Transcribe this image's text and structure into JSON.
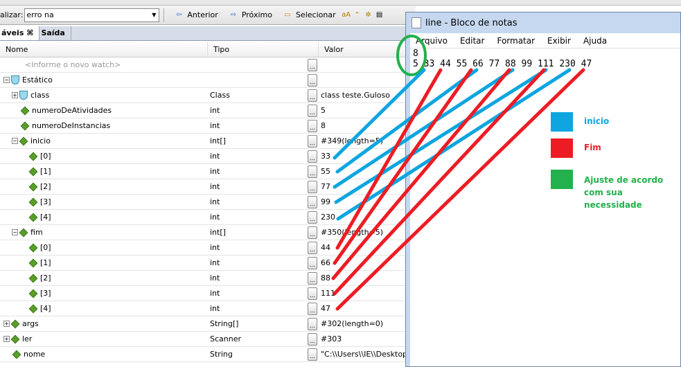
{
  "toolbar": {
    "find_label": "alizar:",
    "find_value": "erro na",
    "prev": "Anterior",
    "next": "Próximo",
    "select": "Selecionar"
  },
  "tabs": [
    {
      "label": "áveis"
    },
    {
      "label": "Saída"
    }
  ],
  "columns": [
    "Nome",
    "Tipo",
    "Valor"
  ],
  "rows": [
    {
      "name": "<Informe o novo watch>",
      "type": "",
      "value": ""
    },
    {
      "name": "Estático",
      "type": "",
      "value": ""
    },
    {
      "name": "class",
      "type": "Class",
      "value": "class teste.Guloso"
    },
    {
      "name": "numeroDeAtividades",
      "type": "int",
      "value": "5"
    },
    {
      "name": "numeroDeInstancias",
      "type": "int",
      "value": "8"
    },
    {
      "name": "inicio",
      "type": "int[]",
      "value": "#349(length=5)"
    },
    {
      "name": "[0]",
      "type": "int",
      "value": "33"
    },
    {
      "name": "[1]",
      "type": "int",
      "value": "55"
    },
    {
      "name": "[2]",
      "type": "int",
      "value": "77"
    },
    {
      "name": "[3]",
      "type": "int",
      "value": "99"
    },
    {
      "name": "[4]",
      "type": "int",
      "value": "230"
    },
    {
      "name": "fim",
      "type": "int[]",
      "value": "#350(length=5)"
    },
    {
      "name": "[0]",
      "type": "int",
      "value": "44"
    },
    {
      "name": "[1]",
      "type": "int",
      "value": "66"
    },
    {
      "name": "[2]",
      "type": "int",
      "value": "88"
    },
    {
      "name": "[3]",
      "type": "int",
      "value": "111"
    },
    {
      "name": "[4]",
      "type": "int",
      "value": "47"
    },
    {
      "name": "args",
      "type": "String[]",
      "value": "#302(length=0)"
    },
    {
      "name": "ler",
      "type": "Scanner",
      "value": "#303"
    },
    {
      "name": "nome",
      "type": "String",
      "value": "\"C:\\\\Users\\\\IE\\\\Desktop\\\\"
    }
  ],
  "notepad": {
    "title": "line - Bloco de notas",
    "menu": [
      "Arquivo",
      "Editar",
      "Formatar",
      "Exibir",
      "Ajuda"
    ],
    "line1": "8",
    "line2": "5 33 44 55 66 77 88 99 111 230 47"
  },
  "legend": [
    {
      "label": "inicio",
      "color": "#0ea5e0"
    },
    {
      "label": "Fim",
      "color": "#ed1c24"
    },
    {
      "label": "Ajuste de acordo com sua necessidade",
      "color": "#22b14c"
    }
  ]
}
